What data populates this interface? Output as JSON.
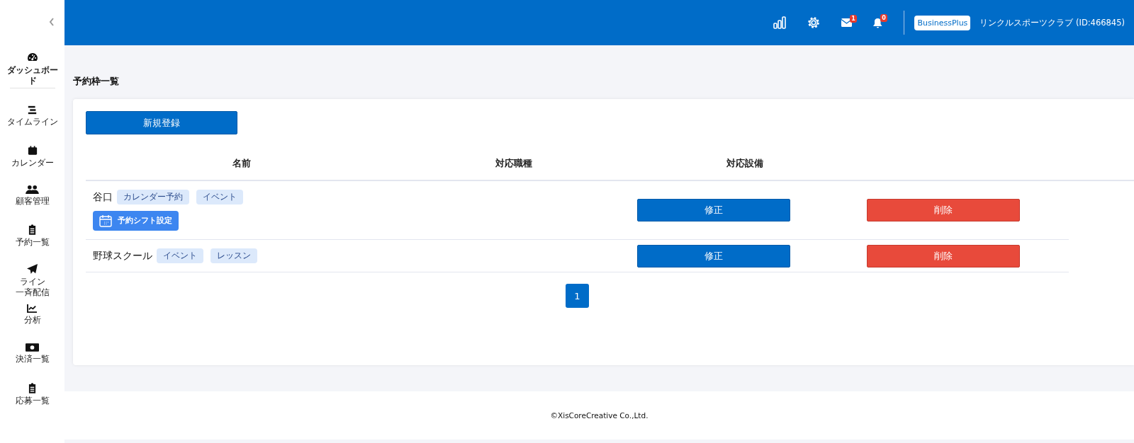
{
  "sidebar": {
    "items": [
      {
        "label": "ダッシュボード",
        "selected": true
      },
      {
        "label": "タイムライン",
        "selected": false
      },
      {
        "label": "カレンダー",
        "selected": false
      },
      {
        "label": "顧客管理",
        "selected": false
      },
      {
        "label": "予約一覧",
        "selected": false
      },
      {
        "lines": [
          "ライン",
          "一斉配信"
        ],
        "selected": false
      },
      {
        "label": "分析",
        "selected": false
      },
      {
        "label": "決済一覧",
        "selected": false
      },
      {
        "label": "応募一覧",
        "selected": false
      }
    ]
  },
  "header": {
    "mail_badge": "1",
    "bell_badge": "0",
    "plan": "BusinessPlus",
    "account": "リンクルスポーツクラブ (ID:466845)"
  },
  "page_title": "予約枠一覧",
  "new_button": "新規登録",
  "table": {
    "columns": [
      "名前",
      "対応職種",
      "対応設備"
    ],
    "rows": [
      {
        "name": "谷口",
        "tags": [
          "カレンダー予約",
          "イベント"
        ],
        "shift_button": "予約シフト設定",
        "edit": "修正",
        "delete": "削除"
      },
      {
        "name": "野球スクール",
        "tags": [
          "イベント",
          "レッスン"
        ],
        "edit": "修正",
        "delete": "削除"
      }
    ]
  },
  "pagination": [
    {
      "label": "1",
      "selected": true
    }
  ],
  "footer": "©XisCoreCreative Co.,Ltd."
}
